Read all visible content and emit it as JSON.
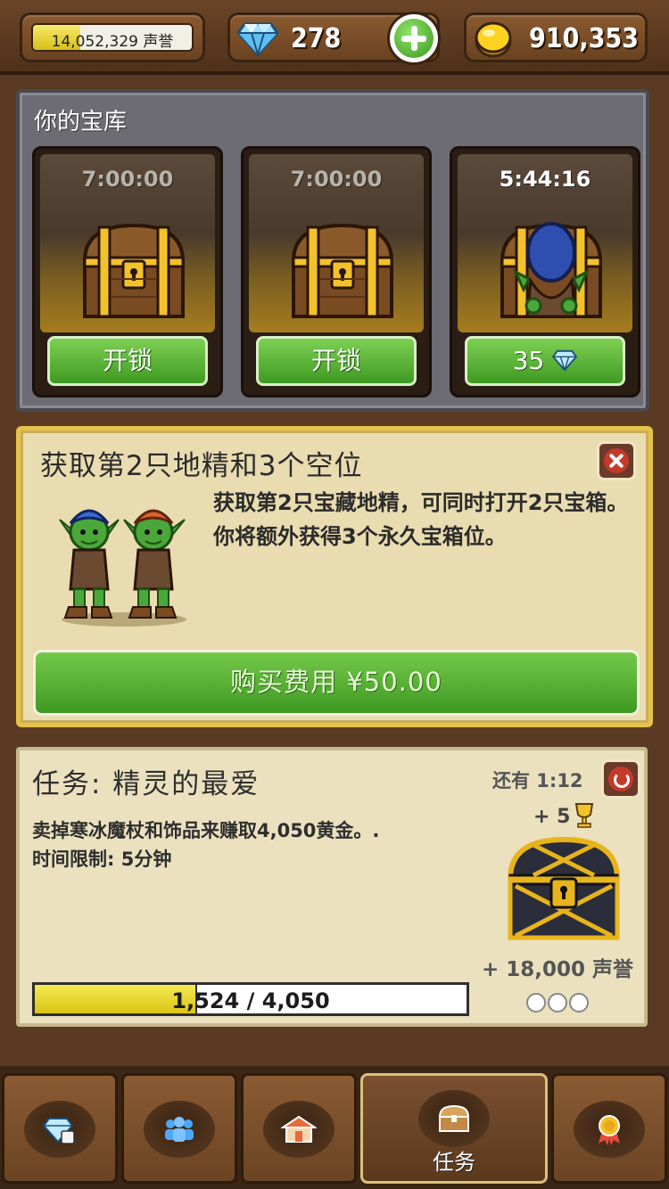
{
  "topbar": {
    "reputation": "14,052,329 声誉",
    "gems": "278",
    "gold": "910,353"
  },
  "vault": {
    "title": "你的宝库",
    "slots": [
      {
        "timer": "7:00:00",
        "button": "开锁"
      },
      {
        "timer": "7:00:00",
        "button": "开锁"
      },
      {
        "timer": "5:44:16",
        "button": "35"
      }
    ]
  },
  "offer": {
    "title": "获取第2只地精和3个空位",
    "description": "获取第2只宝藏地精，可同时打开2只宝箱。你将额外获得3个永久宝箱位。",
    "buy_label": "购买费用 ¥50.00"
  },
  "quest": {
    "title": "任务: 精灵的最爱",
    "description_line1": "卖掉寒冰魔杖和饰品来赚取4,050黄金。.",
    "description_line2": "时间限制: 5分钟",
    "time_left": "还有 1:12",
    "reward_trophy": "+ 5",
    "reward_reputation": "+ 18,000 声誉",
    "progress_text": "1,524 / 4,050",
    "progress_current": 1524,
    "progress_total": 4050
  },
  "nav": {
    "tabs": [
      {
        "icon": "gem-shop-icon"
      },
      {
        "icon": "people-icon"
      },
      {
        "icon": "shop-icon"
      },
      {
        "icon": "chest-icon",
        "label": "任务",
        "active": true
      },
      {
        "icon": "medal-icon"
      }
    ]
  },
  "colors": {
    "wood": "#6b4527",
    "green_button": "#4aa828",
    "offer_border": "#e6c348",
    "panel_parchment": "#ebe1bf"
  }
}
